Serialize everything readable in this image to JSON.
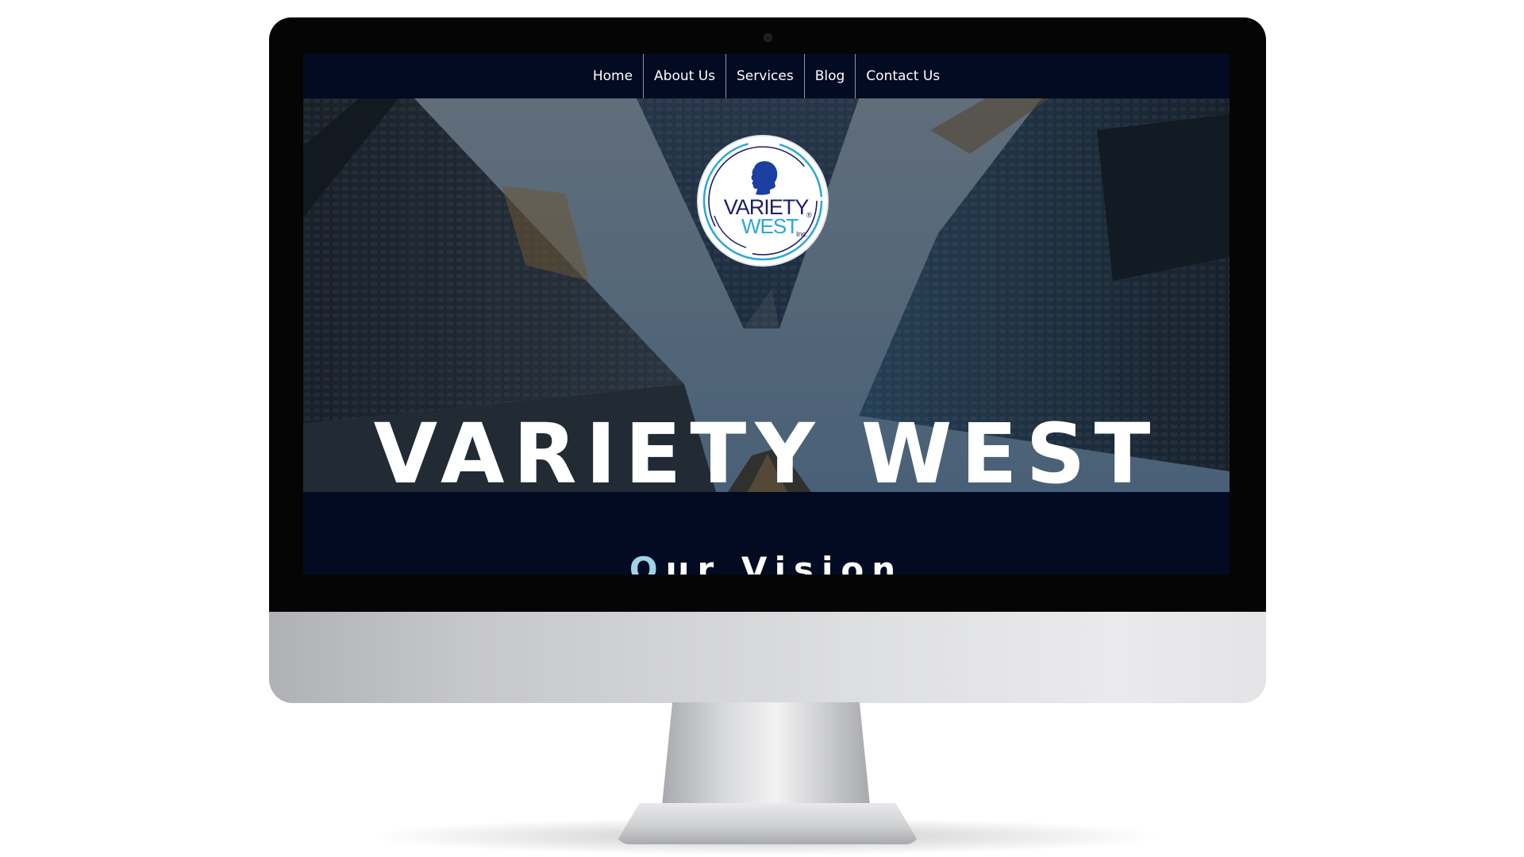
{
  "nav": {
    "items": [
      {
        "label": "Home"
      },
      {
        "label": "About Us"
      },
      {
        "label": "Services"
      },
      {
        "label": "Blog"
      },
      {
        "label": "Contact Us"
      }
    ]
  },
  "logo": {
    "line1": "VARIETY",
    "line2": "WEST",
    "suffix": "Inc.",
    "reg": "®",
    "icon": "head-silhouette-icon"
  },
  "hero": {
    "title": "VARIETY WEST"
  },
  "vision": {
    "first_letter": "O",
    "rest": "ur Vision"
  },
  "colors": {
    "nav_bg": "#020b22",
    "logo_navy": "#1b1f66",
    "logo_cyan": "#2aa7d9",
    "vision_accent": "#9fd3ea"
  }
}
